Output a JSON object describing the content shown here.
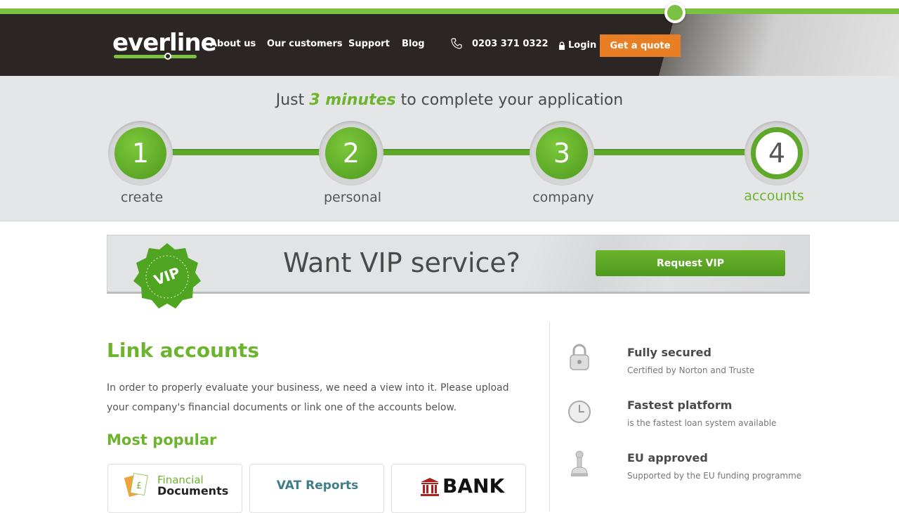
{
  "header": {
    "logo": "everline",
    "nav": [
      "About us",
      "Our customers",
      "Support",
      "Blog"
    ],
    "phone": "0203 371 0322",
    "login": "Login",
    "cta": "Get a quote",
    "accent": "#7cc242",
    "cta_color": "#e97f24"
  },
  "progress": {
    "headline_prefix": "Just",
    "headline_emphasis": "3 minutes",
    "headline_suffix": "to complete your application",
    "steps": [
      {
        "number": "1",
        "label": "create",
        "active": false
      },
      {
        "number": "2",
        "label": "personal",
        "active": false
      },
      {
        "number": "3",
        "label": "company",
        "active": false
      },
      {
        "number": "4",
        "label": "accounts",
        "active": true
      }
    ]
  },
  "vip": {
    "badge": "VIP",
    "title": "Want VIP service?",
    "button": "Request VIP"
  },
  "main": {
    "title": "Link accounts",
    "intro": "In order to properly evaluate your business, we need a view into it. Please upload your company's financial documents or link one of the accounts below.",
    "popular_title": "Most popular",
    "cards": [
      {
        "line1": "Financial",
        "line2": "Documents",
        "icon": "documents-icon"
      },
      {
        "label": "VAT Reports"
      },
      {
        "label": "BANK",
        "icon": "bank-icon"
      }
    ]
  },
  "features": [
    {
      "title": "Fully secured",
      "desc": "Certified by Norton and Truste",
      "icon": "padlock-icon"
    },
    {
      "title": "Fastest platform",
      "desc": "is the fastest loan system available",
      "icon": "clock-icon"
    },
    {
      "title": "EU approved",
      "desc": "Supported by the EU funding programme",
      "icon": "stamp-icon"
    }
  ]
}
